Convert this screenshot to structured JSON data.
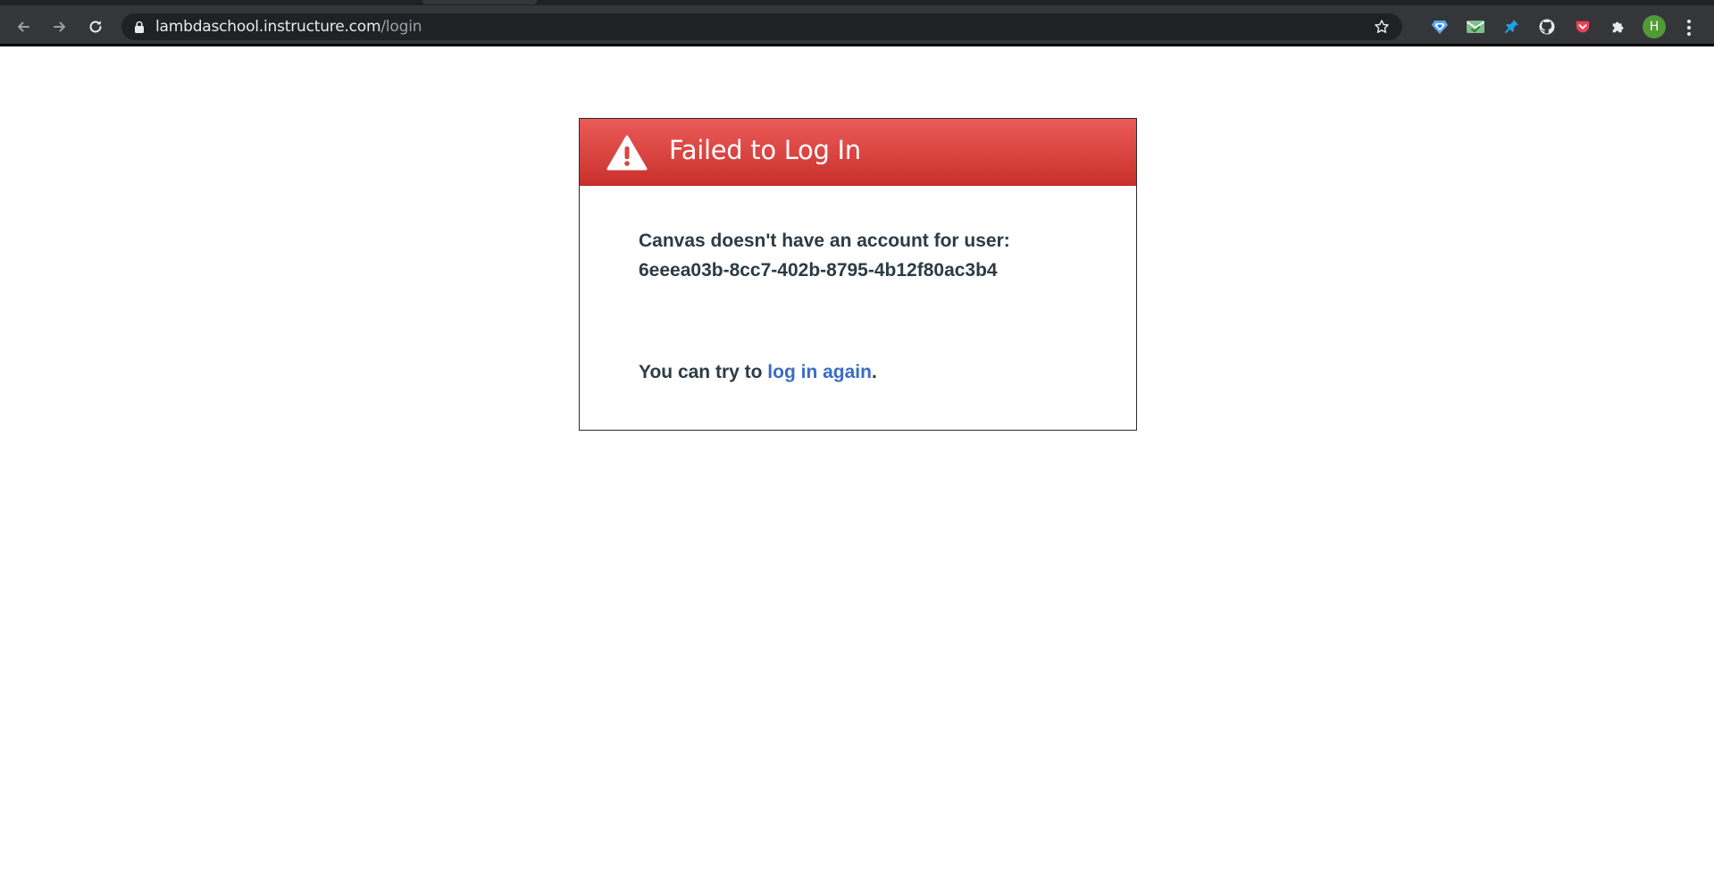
{
  "browser": {
    "url_host": "lambdaschool.instructure.com",
    "url_path": "/login",
    "avatar_initial": "H",
    "extensions": [
      "diamond-extension-icon",
      "mail-checker-icon",
      "pushpin-icon",
      "github-icon",
      "pocket-icon",
      "extensions-puzzle-icon"
    ]
  },
  "dialog": {
    "title": "Failed to Log In",
    "message_line1": "Canvas doesn't have an account for user:",
    "user_id": "6eeea03b-8cc7-402b-8795-4b12f80ac3b4",
    "retry_prefix": "You can try to ",
    "retry_link": "log in again",
    "retry_suffix": "."
  },
  "colors": {
    "header_red": "#d94440",
    "link_blue": "#3a6bc7",
    "text_dark": "#2d3b45"
  }
}
